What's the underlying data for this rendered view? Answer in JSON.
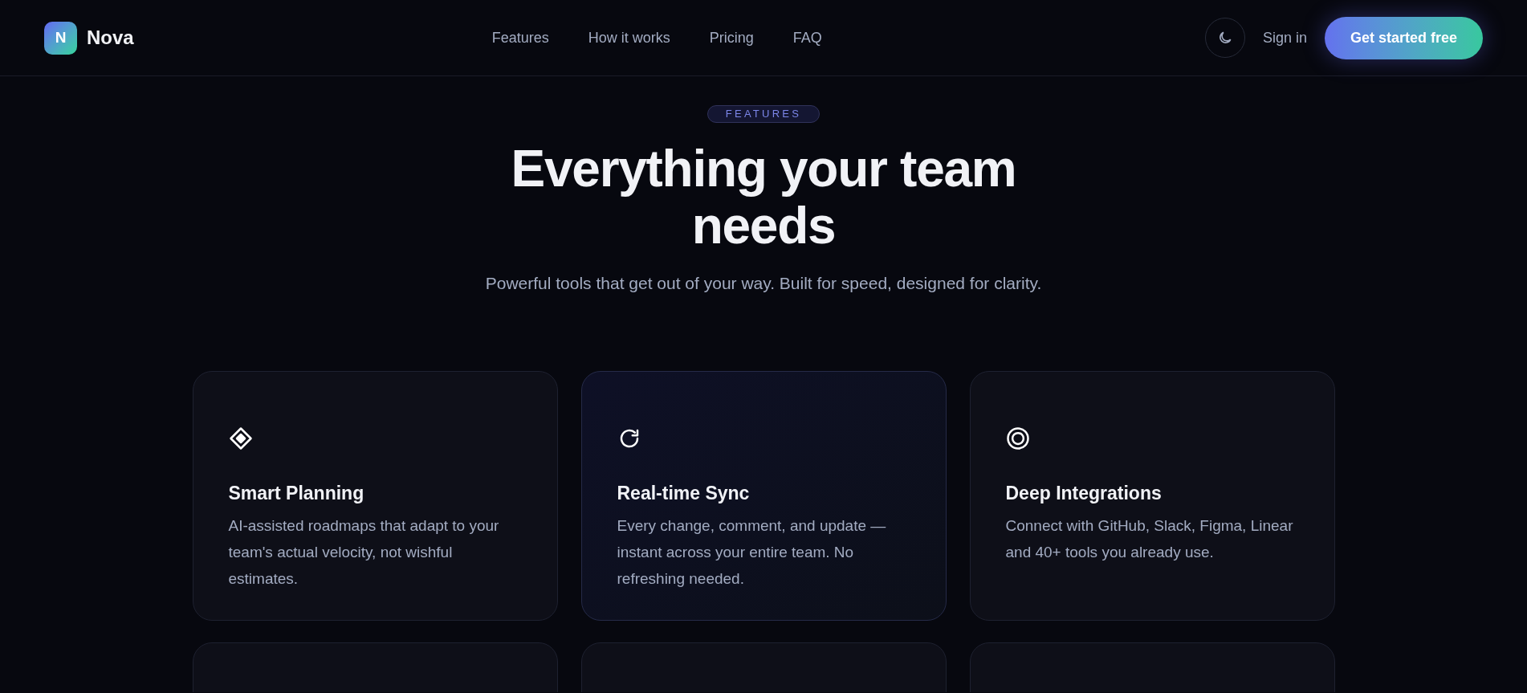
{
  "brand": {
    "logo_letter": "N",
    "name": "Nova"
  },
  "nav": {
    "links": [
      "Features",
      "How it works",
      "Pricing",
      "FAQ"
    ],
    "sign_in": "Sign in",
    "cta": "Get started free"
  },
  "hero": {
    "badge": "FEATURES",
    "title": "Everything your team needs",
    "subtitle": "Powerful tools that get out of your way. Built for speed, designed for clarity."
  },
  "cards": [
    {
      "kind": "diamond",
      "title": "Smart Planning",
      "description": "AI-assisted roadmaps that adapt to your team's actual velocity, not wishful estimates.",
      "highlighted": false
    },
    {
      "kind": "refresh",
      "title": "Real-time Sync",
      "description": "Every change, comment, and update — instant across your entire team. No refreshing needed.",
      "highlighted": true
    },
    {
      "kind": "rings",
      "title": "Deep Integrations",
      "description": "Connect with GitHub, Slack, Figma, Linear and 40+ tools you already use.",
      "highlighted": false
    }
  ],
  "cut_off_cards": [
    {
      "highlighted": false
    },
    {
      "highlighted": false
    },
    {
      "highlighted": false
    }
  ]
}
